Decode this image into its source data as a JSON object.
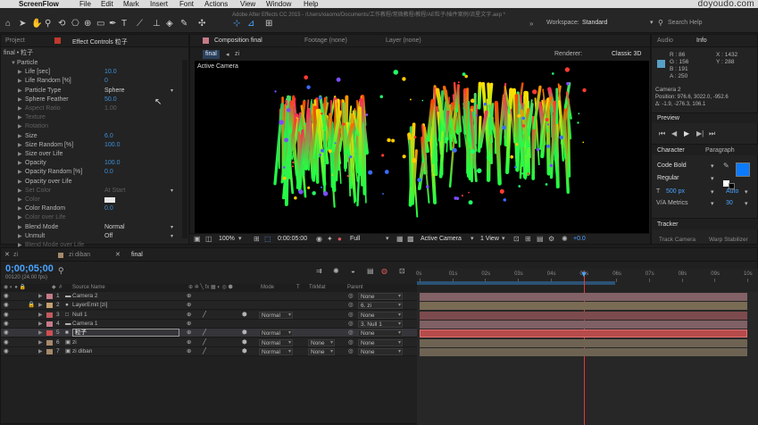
{
  "menubar": {
    "app": "ScreenFlow",
    "items": [
      "File",
      "Edit",
      "Mark",
      "Insert",
      "Font",
      "Actions",
      "View",
      "Window",
      "Help"
    ],
    "watermark": "doyoudo.com"
  },
  "titlebar": {
    "path": "Adobe After Effects CC 2015 - /Users/xiaomo/Documents/工作教程/常微教程/教程/AE粒子/插件案例/流星文字.aep *"
  },
  "toolbar": {
    "workspace_label": "Workspace:",
    "workspace_value": "Standard",
    "search_placeholder": "Search Help"
  },
  "left_panel": {
    "tab_project": "Project",
    "tab_effect": "Effect Controls 粒子",
    "breadcrumb": "final • 粒子",
    "rows": [
      {
        "label": "Particle",
        "value": "",
        "style": "group"
      },
      {
        "label": "Life [sec]",
        "value": "10.0"
      },
      {
        "label": "Life Random [%]",
        "value": "0"
      },
      {
        "label": "Particle Type",
        "value": "Sphere",
        "dropdown": true
      },
      {
        "label": "Sphere Feather",
        "value": "50.0"
      },
      {
        "label": "Aspect Ratio",
        "value": "1.00",
        "dim": true
      },
      {
        "label": "Texture",
        "value": "",
        "dim": true
      },
      {
        "label": "Rotation",
        "value": "",
        "dim": true
      },
      {
        "label": "Size",
        "value": "6.0"
      },
      {
        "label": "Size Random [%]",
        "value": "100.0"
      },
      {
        "label": "Size over Life",
        "value": ""
      },
      {
        "label": "Opacity",
        "value": "100.0"
      },
      {
        "label": "Opacity Random [%]",
        "value": "0.0"
      },
      {
        "label": "Opacity over Life",
        "value": ""
      },
      {
        "label": "Set Color",
        "value": "At Start",
        "dim": true,
        "dropdown": true
      },
      {
        "label": "Color",
        "value": "",
        "dim": true
      },
      {
        "label": "Color Random",
        "value": "0.0"
      },
      {
        "label": "Color over Life",
        "value": "",
        "dim": true
      },
      {
        "label": "Blend Mode",
        "value": "Normal",
        "dropdown": true
      },
      {
        "label": "Unmult",
        "value": "Off",
        "dropdown": true
      },
      {
        "label": "Blend Mode over Life",
        "value": "",
        "dim": true
      }
    ]
  },
  "comp_panel": {
    "tab_comp": "Composition final",
    "tab_footage": "Footage (none)",
    "tab_layer": "Layer (none)",
    "crumb_final": "final",
    "crumb_zi": "zi",
    "renderer_label": "Renderer:",
    "renderer_value": "Classic 3D",
    "active_camera": "Active Camera",
    "bottom": {
      "zoom": "100%",
      "timecode": "0:00:05:00",
      "resolution": "Full",
      "camera": "Active Camera",
      "view": "1 View",
      "exposure": "+0.0"
    }
  },
  "right_panel": {
    "tab_audio": "Audio",
    "tab_info": "Info",
    "info": {
      "r": "R : 86",
      "g": "G : 156",
      "b": "B : 191",
      "a": "A : 250",
      "x": "X : 1432",
      "y": "Y : 288",
      "layer": "Camera 2",
      "position": "Position: 976.6, 3022.0, -952.6",
      "delta": "Δ: -1.9, -276.3, 106.1",
      "swatch_color": "#56a0c6"
    },
    "preview_title": "Preview",
    "character_title": "Character",
    "paragraph_title": "Paragraph",
    "font_name": "Code Bold",
    "font_style": "Regular",
    "font_size": "500 px",
    "leading": "Auto",
    "kerning_label": "Metrics",
    "tracking": "30",
    "fill_color": "#0a7bff",
    "tracker_title": "Tracker",
    "track_camera": "Track Camera",
    "warp_stabilizer": "Warp Stabilizer"
  },
  "timeline": {
    "tabs": [
      {
        "label": "zi"
      },
      {
        "label": "zi diban"
      },
      {
        "label": "final",
        "active": true
      }
    ],
    "timecode": "0;00;05;00",
    "frame_info": "00120 (24.00 fps)",
    "headers": {
      "source_name": "Source Name",
      "mode": "Mode",
      "t": "T",
      "trkmat": "TrkMat",
      "parent": "Parent"
    },
    "ruler": [
      "0s",
      "01s",
      "02s",
      "03s",
      "04s",
      "05s",
      "06s",
      "07s",
      "08s",
      "09s",
      "10s"
    ],
    "playhead_seconds": 5,
    "duration_seconds": 10,
    "layers": [
      {
        "num": "1",
        "name": "Camera 2",
        "mode": "",
        "trkmat": "",
        "parent": "None",
        "label": "#c77b88",
        "bar": "#826266"
      },
      {
        "num": "2",
        "name": "LayerEmit [zi]",
        "mode": "",
        "trkmat": "",
        "parent": "6. zi",
        "label": "#c4a06e",
        "bar": "#7a6b55"
      },
      {
        "num": "3",
        "name": "Null 1",
        "mode": "Normal",
        "trkmat": "",
        "parent": "None",
        "label": "#c35a60",
        "bar": "#7c4b4e"
      },
      {
        "num": "4",
        "name": "Camera 1",
        "mode": "",
        "trkmat": "",
        "parent": "3. Null 1",
        "label": "#c77b88",
        "bar": "#7f6064"
      },
      {
        "num": "5",
        "name": "粒子",
        "mode": "Normal",
        "trkmat": "",
        "parent": "None",
        "label": "#d05050",
        "bar": "#b74b4b",
        "selected": true
      },
      {
        "num": "6",
        "name": "zi",
        "mode": "Normal",
        "trkmat": "None",
        "parent": "None",
        "label": "#a6896a",
        "bar": "#6e6353"
      },
      {
        "num": "7",
        "name": "zi diban",
        "mode": "Normal",
        "trkmat": "None",
        "parent": "None",
        "label": "#a6896a",
        "bar": "#6e6353"
      }
    ]
  },
  "colors": {
    "accent_blue": "#2f8fff",
    "selection_red": "#d05050",
    "playhead": "#e53935"
  }
}
